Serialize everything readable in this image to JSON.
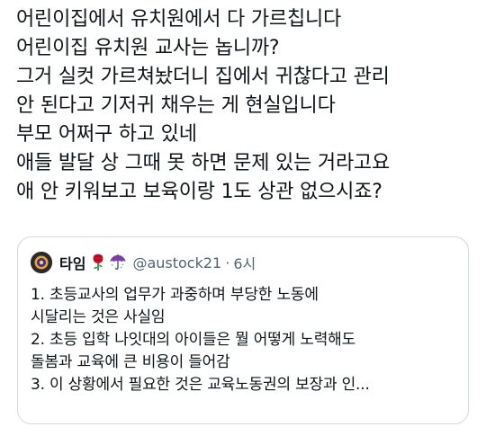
{
  "tweet": {
    "lines": [
      "어린이집에서 유치원에서 다 가르칩니다",
      "어린이집 유치원 교사는 놉니까?",
      "그거 실컷 가르쳐놨더니 집에서 귀찮다고 관리",
      "안 된다고 기저귀 채우는 게 현실입니다",
      "부모 어쩌구 하고 있네",
      "애들 발달 상 그때 못 하면 문제 있는 거라고요",
      "애 안 키워보고 보육이랑 1도 상관 없으시죠?"
    ]
  },
  "quote": {
    "name": "타임",
    "emojis": [
      "rose-icon",
      "umbrella-icon"
    ],
    "handle": "@austock21",
    "separator": "·",
    "time": "6시",
    "lines": [
      "1. 초등교사의 업무가 과중하며 부당한 노동에",
      "시달리는 것은 사실임",
      "2. 초등 입학 나잇대의 아이들은 뭘 어떻게 노력해도",
      "돌봄과 교육에 큰 비용이 들어감",
      "3. 이 상황에서 필요한 것은 교육노동권의 보장과 인..."
    ]
  },
  "colors": {
    "text": "#0f1419",
    "secondary": "#536471",
    "border": "#cfd9de",
    "rose": "#c8102e",
    "umbrella": "#7b3fa0"
  }
}
